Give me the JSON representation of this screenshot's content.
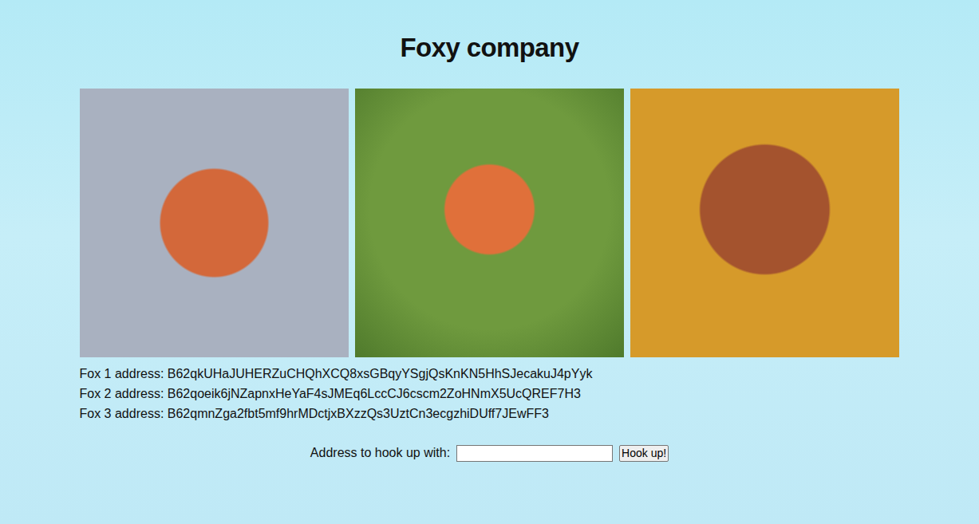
{
  "title": "Foxy company",
  "photos": [
    {
      "alt": ""
    },
    {
      "alt": ""
    },
    {
      "alt": ""
    }
  ],
  "addresses": [
    "Fox 1 address: B62qkUHaJUHERZuCHQhXCQ8xsGBqyYSgjQsKnKN5HhSJecakuJ4pYyk",
    "Fox 2 address: B62qoeik6jNZapnxHeYaF4sJMEq6LccCJ6cscm2ZoHNmX5UcQREF7H3",
    "Fox 3 address: B62qmnZga2fbt5mf9hrMDctjxBXzzQs3UztCn3ecgzhiDUff7JEwFF3"
  ],
  "form": {
    "label": "Address to hook up with:",
    "value": "",
    "button": "Hook up!"
  }
}
